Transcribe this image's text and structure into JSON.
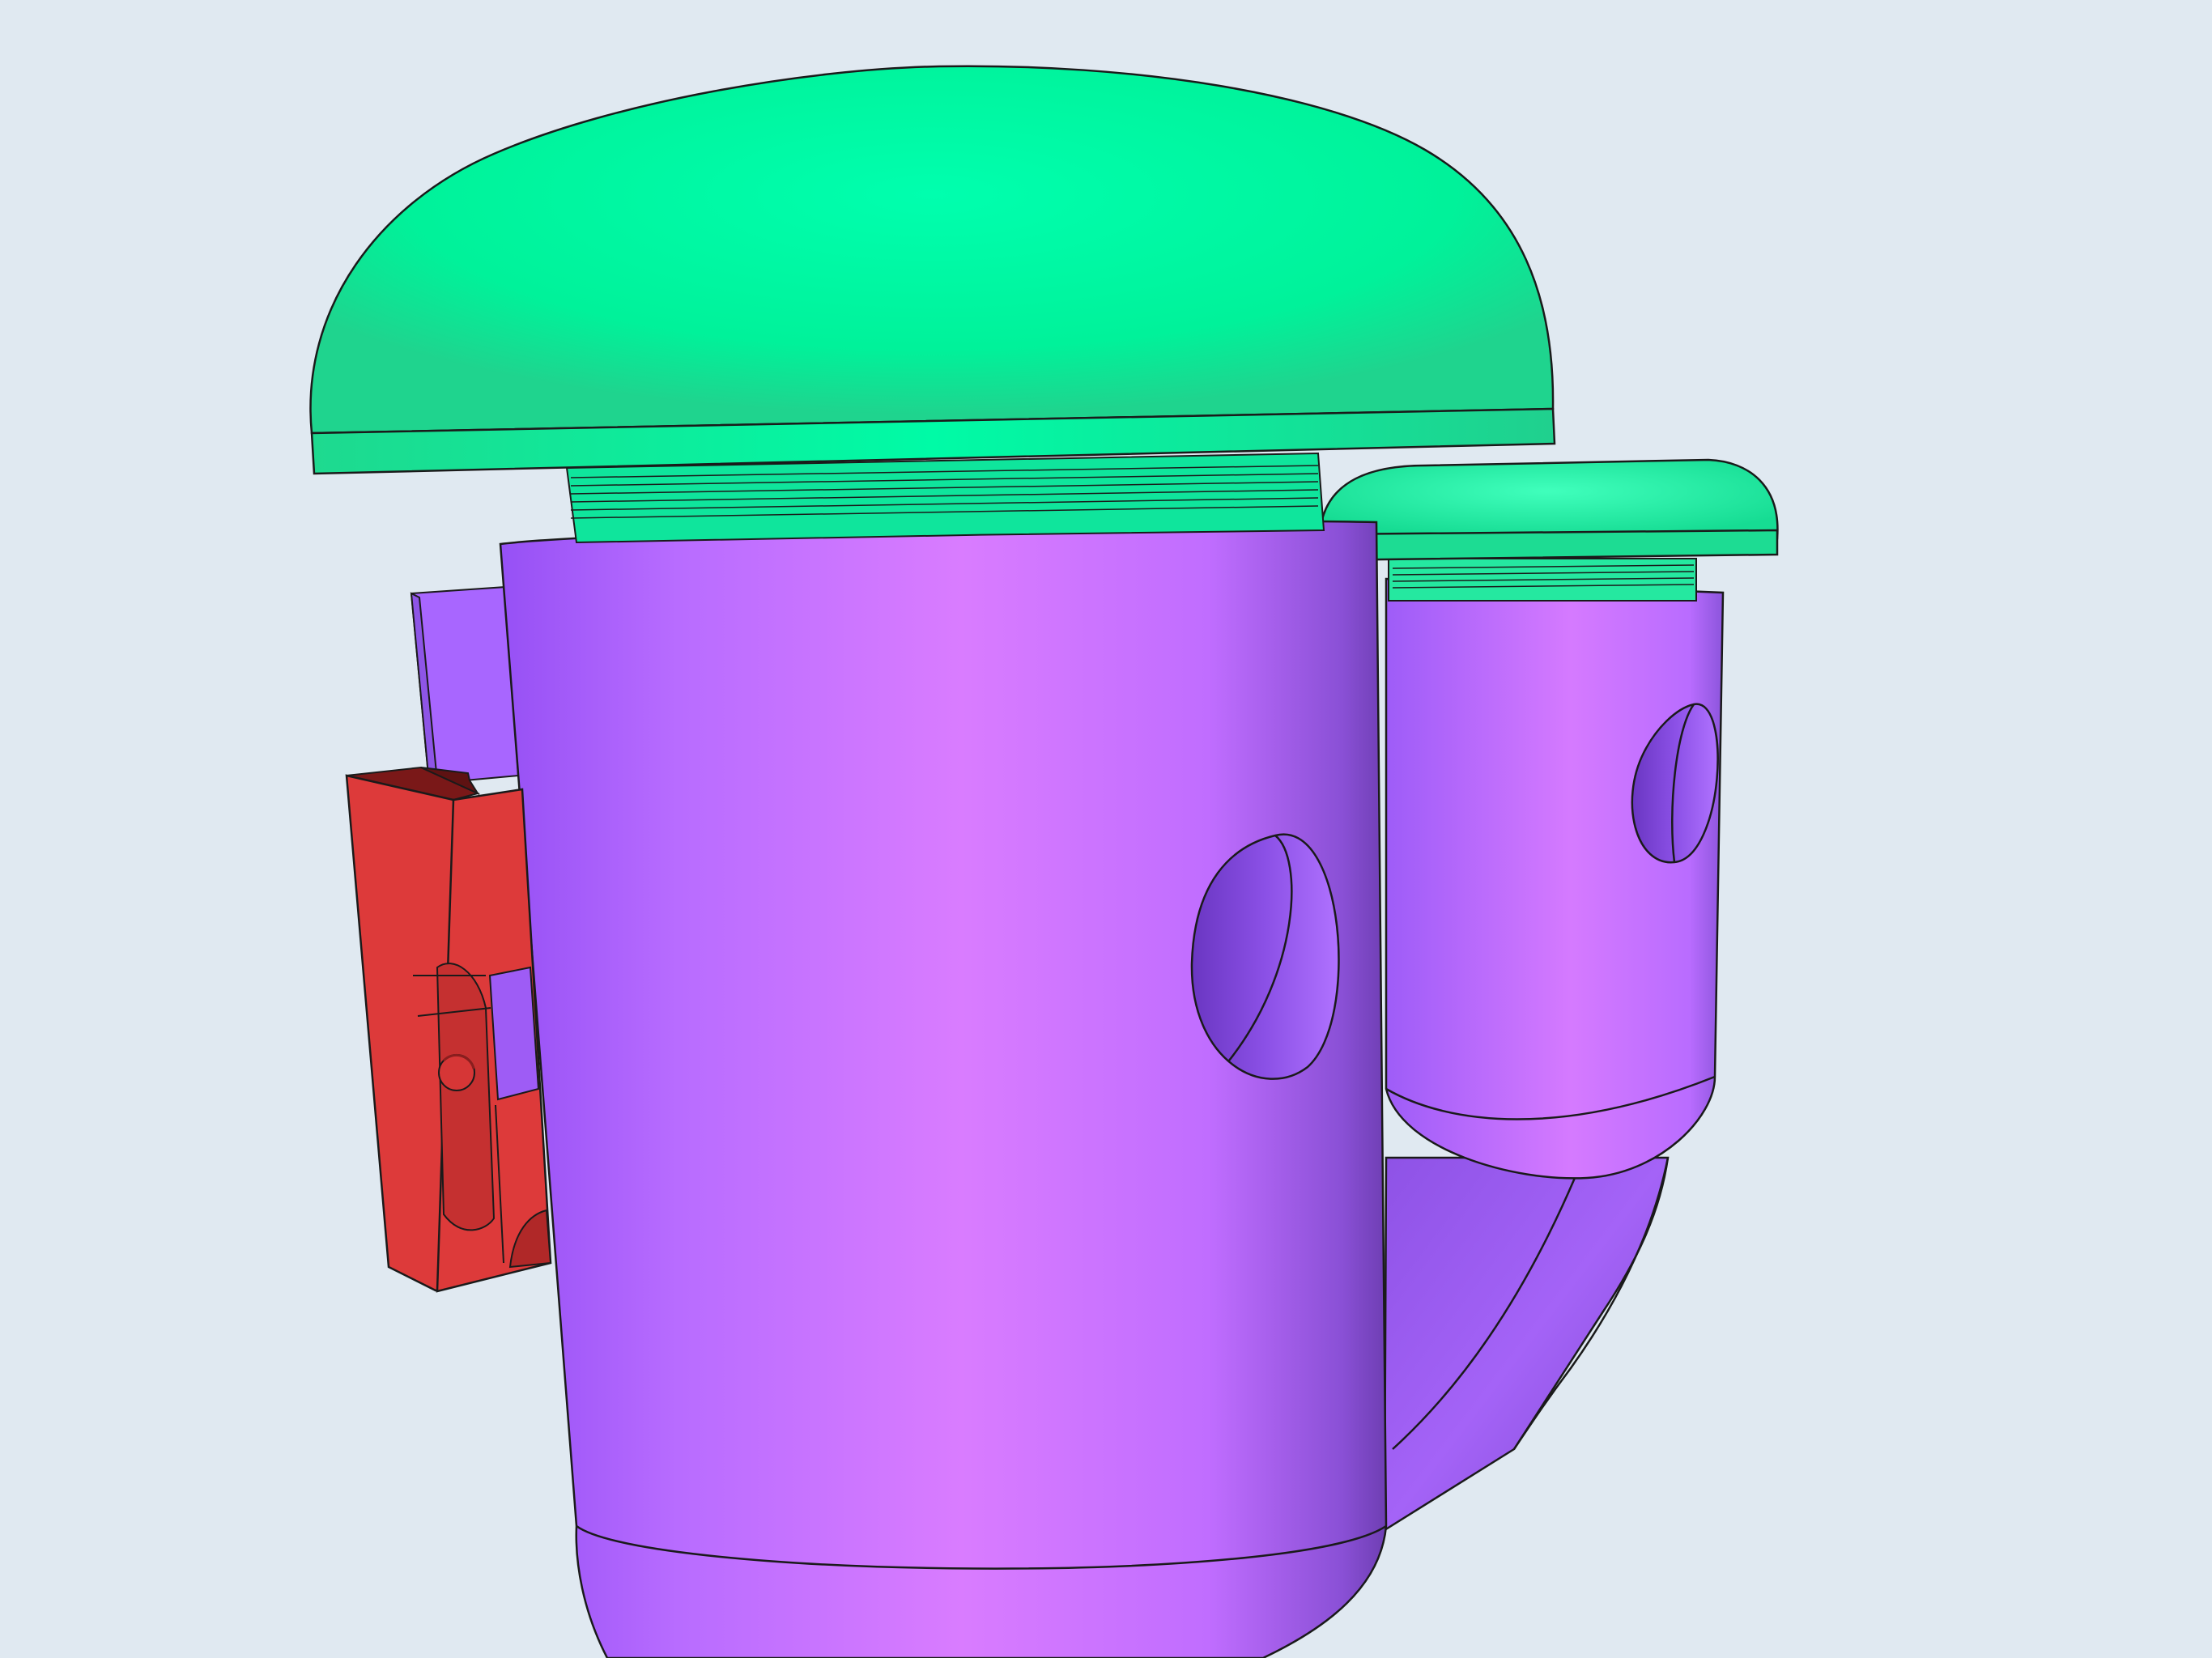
{
  "scene": {
    "background": "#e0e9f1",
    "outline": "#1a1a1a",
    "parts": {
      "large_cap": {
        "kind": "dome-cap",
        "color": "#00f29a",
        "highlight": "#00ffae",
        "shade": "#23c78a"
      },
      "small_cap": {
        "kind": "dome-cap",
        "color": "#1ef0a0",
        "highlight": "#40ffbc",
        "shade": "#23c78a"
      },
      "large_body": {
        "kind": "cylinder",
        "color": "#c678ff",
        "highlight": "#d97cff",
        "shade": "#8a4fe0"
      },
      "small_body": {
        "kind": "cylinder",
        "color": "#c070ff",
        "highlight": "#d57aff",
        "shade": "#8a4fe0"
      },
      "elbow_pipe": {
        "kind": "curved-pipe",
        "color": "#9e5cf5",
        "shade": "#7a45cc"
      },
      "back_plate": {
        "kind": "mount-plate",
        "color": "#a866ff"
      },
      "mount_block": {
        "kind": "clip-block",
        "color": "#dd3a3a",
        "top": "#7a1818",
        "side": "#b32a2a"
      }
    }
  }
}
